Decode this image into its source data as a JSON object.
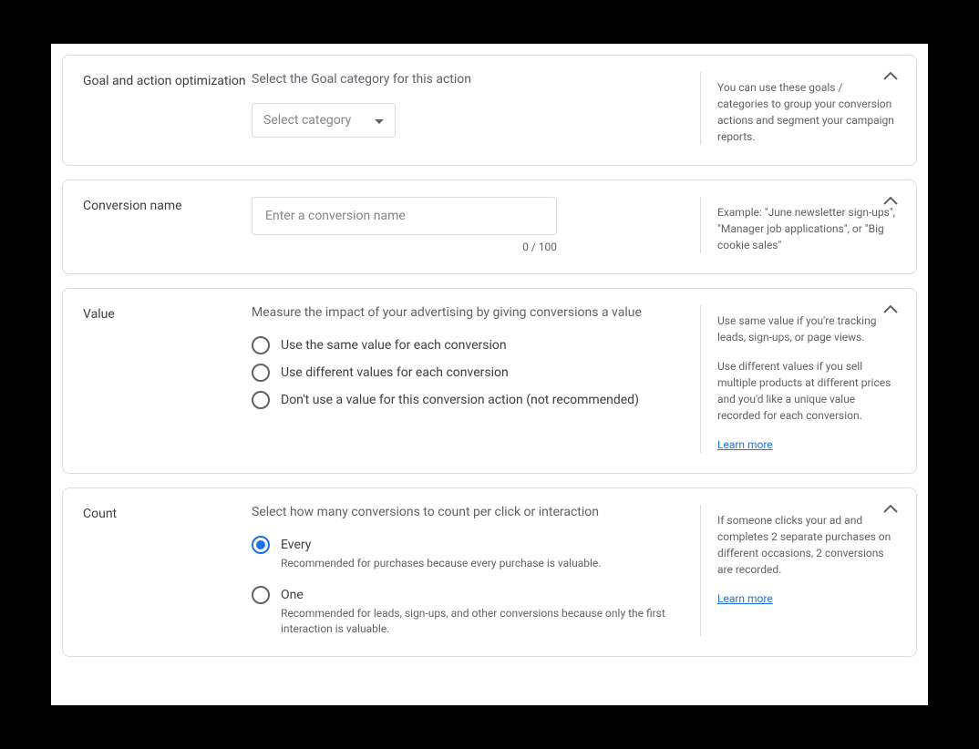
{
  "goal": {
    "title": "Goal and action optimization",
    "subtitle": "Select the Goal category for this action",
    "selectPlaceholder": "Select category",
    "help": "You can use these goals / categories to group your conversion actions and segment your campaign reports."
  },
  "conversionName": {
    "title": "Conversion name",
    "placeholder": "Enter a conversion name",
    "charCount": "0 / 100",
    "help": "Example: \"June newsletter sign-ups\", \"Manager job applications\", or \"Big cookie sales\""
  },
  "value": {
    "title": "Value",
    "subtitle": "Measure the impact of your advertising by giving conversions a value",
    "options": {
      "same": "Use the same value for each conversion",
      "diff": "Use different values for each conversion",
      "none": "Don't use a value for this conversion action (not recommended)"
    },
    "help1": "Use same value if you're tracking leads, sign-ups, or page views.",
    "help2": "Use different values if you sell multiple products at different prices and you'd like a unique value recorded for each conversion.",
    "learnMore": "Learn more"
  },
  "count": {
    "title": "Count",
    "subtitle": "Select how many conversions to count per click or interaction",
    "options": {
      "every": {
        "label": "Every",
        "desc": "Recommended for purchases because every purchase is valuable."
      },
      "one": {
        "label": "One",
        "desc": "Recommended for leads, sign-ups, and other conversions because only the first interaction is valuable."
      }
    },
    "help": "If someone clicks your ad and completes 2 separate purchases on different occasions, 2 conversions are recorded.",
    "learnMore": "Learn more"
  }
}
